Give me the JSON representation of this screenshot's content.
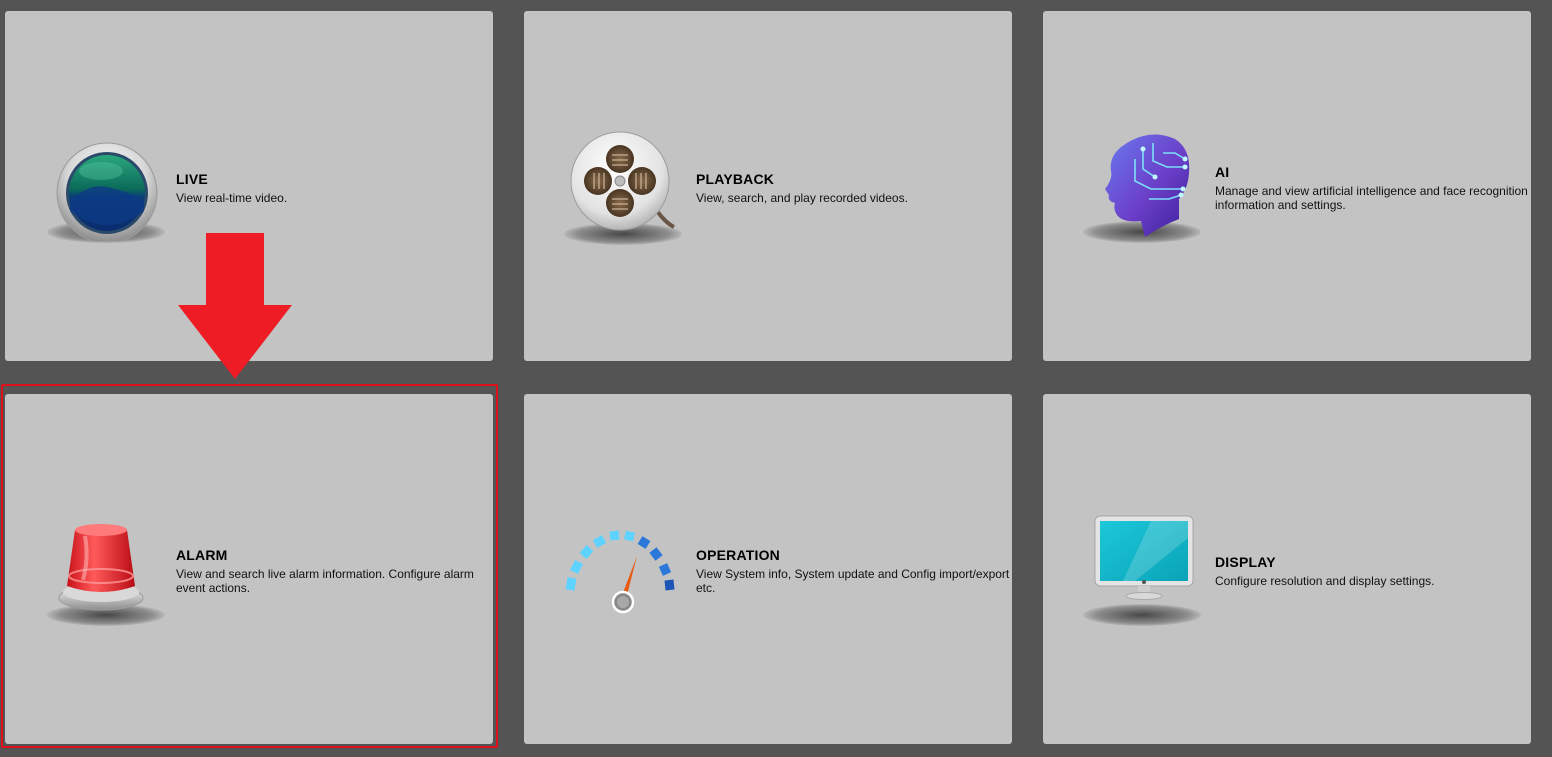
{
  "tiles": [
    {
      "key": "live",
      "title": "LIVE",
      "description": "View real-time video.",
      "icon": "live-lens-icon"
    },
    {
      "key": "playback",
      "title": "PLAYBACK",
      "description": "View, search, and play recorded videos.",
      "icon": "film-reel-icon"
    },
    {
      "key": "ai",
      "title": "AI",
      "description": "Manage and view artificial intelligence and face recognition information and settings.",
      "icon": "ai-head-icon"
    },
    {
      "key": "alarm",
      "title": "ALARM",
      "description": "View and search live alarm information. Configure alarm event actions.",
      "icon": "alarm-siren-icon"
    },
    {
      "key": "operation",
      "title": "OPERATION",
      "description": "View System info, System update and Config import/export etc.",
      "icon": "speedometer-icon"
    },
    {
      "key": "display",
      "title": "DISPLAY",
      "description": "Configure resolution and display settings.",
      "icon": "monitor-icon"
    }
  ],
  "annotation": {
    "arrow_icon": "red-down-arrow-icon",
    "arrow_color": "#ee1c24",
    "highlight_color": "#e0101a",
    "highlighted_tile": "alarm"
  },
  "colors": {
    "background": "#545454",
    "tile": "#c3c3c3"
  }
}
